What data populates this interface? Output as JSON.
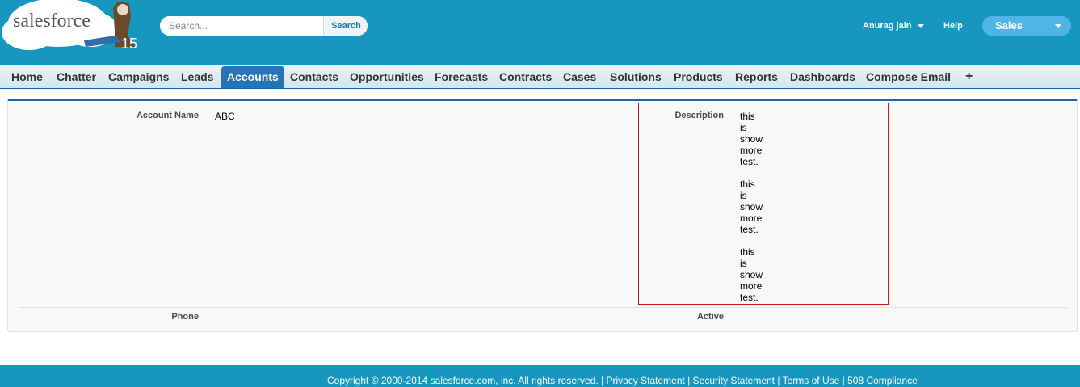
{
  "header": {
    "logo_text": "salesforce",
    "logo_badge": "15",
    "search_placeholder": "Search...",
    "search_button": "Search",
    "user_name": "Anurag jain",
    "help_label": "Help",
    "app_name": "Sales"
  },
  "tabs": [
    {
      "label": "Home",
      "active": false
    },
    {
      "label": "Chatter",
      "active": false
    },
    {
      "label": "Campaigns",
      "active": false
    },
    {
      "label": "Leads",
      "active": false
    },
    {
      "label": "Accounts",
      "active": true
    },
    {
      "label": "Contacts",
      "active": false
    },
    {
      "label": "Opportunities",
      "active": false
    },
    {
      "label": "Forecasts",
      "active": false
    },
    {
      "label": "Contracts",
      "active": false
    },
    {
      "label": "Cases",
      "active": false
    },
    {
      "label": "Solutions",
      "active": false
    },
    {
      "label": "Products",
      "active": false
    },
    {
      "label": "Reports",
      "active": false
    },
    {
      "label": "Dashboards",
      "active": false
    },
    {
      "label": "Compose Email",
      "active": false
    }
  ],
  "tab_plus": "+",
  "detail": {
    "account_name_label": "Account Name",
    "account_name_value": "ABC",
    "description_label": "Description",
    "description_lines": [
      "this",
      "is",
      "show",
      "more",
      "test.",
      "",
      "this",
      "is",
      "show",
      "more",
      "test.",
      "",
      "this",
      "is",
      "show",
      "more",
      "test."
    ],
    "phone_label": "Phone",
    "active_label": "Active"
  },
  "footer": {
    "copyright": "Copyright © 2000-2014 salesforce.com, inc. All rights reserved.",
    "privacy": "Privacy Statement",
    "security": "Security Statement",
    "terms": "Terms of Use",
    "compliance": "508 Compliance"
  },
  "colors": {
    "header_bg": "#1797c0",
    "active_tab": "#2773b8",
    "highlight_border": "#c0191e"
  }
}
